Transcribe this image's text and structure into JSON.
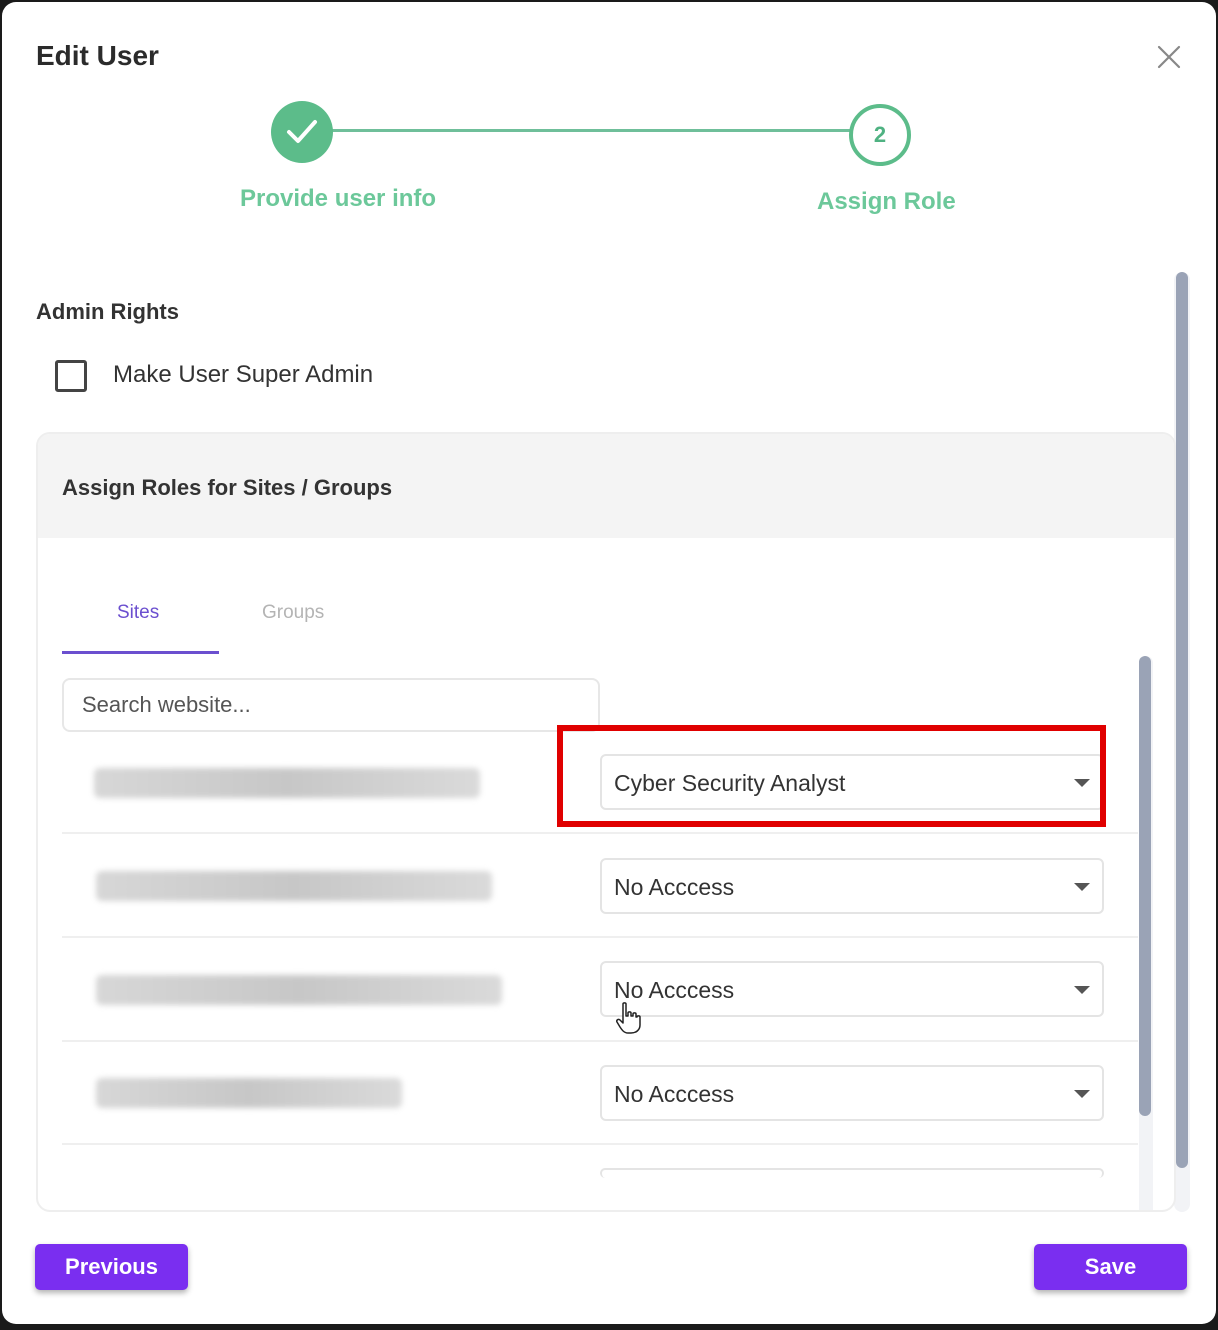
{
  "dialog": {
    "title": "Edit User"
  },
  "stepper": {
    "step1_label": "Provide user info",
    "step2_number": "2",
    "step2_label": "Assign Role"
  },
  "admin": {
    "section_title": "Admin Rights",
    "checkbox_label": "Make User Super Admin",
    "checked": false
  },
  "roles": {
    "section_title": "Assign Roles for Sites / Groups",
    "tabs": [
      {
        "label": "Sites",
        "active": true
      },
      {
        "label": "Groups",
        "active": false
      }
    ],
    "search_placeholder": "Search website...",
    "rows": [
      {
        "role": "Cyber Security Analyst"
      },
      {
        "role": "No Acccess"
      },
      {
        "role": "No Acccess"
      },
      {
        "role": "No Acccess"
      }
    ]
  },
  "footer": {
    "previous_label": "Previous",
    "save_label": "Save"
  },
  "colors": {
    "accent": "#7a2ef0",
    "step_green": "#5cbc8a",
    "tab_active": "#6b4fcf",
    "highlight": "#e00000"
  }
}
